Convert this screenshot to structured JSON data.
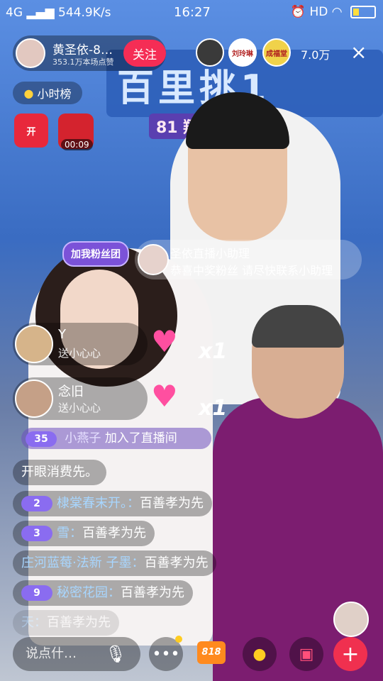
{
  "status_bar": {
    "network": "4G",
    "speed": "544.9K/s",
    "time": "16:27",
    "hd": "HD"
  },
  "header": {
    "host_name": "黄圣依-8…",
    "host_stats": "353.1万本场点赞",
    "follow_label": "关注",
    "viewer_count": "7.0万",
    "close_icon": "×",
    "viewers": [
      "",
      "刘玲琳",
      "成福堂"
    ]
  },
  "hourly_rank": "小时榜",
  "gift_box_label": "开",
  "red_packet_timer": "00:09",
  "banner": {
    "title": "百里挑1",
    "subtitle": "81  翔好物节"
  },
  "fan_club_badge": "加我粉丝团",
  "notice": {
    "title": "圣依直播小助理",
    "text": "恭喜中奖粉丝 请尽快联系小助理"
  },
  "gifts": [
    {
      "name": "Y",
      "action": "送小心心",
      "multiplier": "x1"
    },
    {
      "name": "念旧",
      "action": "送小心心",
      "multiplier": "x1"
    }
  ],
  "joined": {
    "level": "35",
    "name": "小燕子",
    "text": "加入了直播间"
  },
  "chat": {
    "plain": "开眼消费先。",
    "messages": [
      {
        "level": "2",
        "user": "棣棠春末开。：",
        "text": "百善孝为先"
      },
      {
        "level": "3",
        "user": "雪：",
        "text": "百善孝为先"
      },
      {
        "level": "",
        "user": "庄河蓝莓·法新  子墨：",
        "text": "百善孝为先"
      },
      {
        "level": "9",
        "user": "秘密花园：",
        "text": "百善孝为先"
      },
      {
        "level": "",
        "user": "天：",
        "text": "百善孝为先"
      }
    ]
  },
  "bottom": {
    "input_placeholder": "说点什…",
    "more_icon": "•••",
    "badge_818": "818",
    "plus_icon": "+"
  },
  "colors": {
    "follow": "#f52d55",
    "accent_purple": "#7b52d8"
  }
}
